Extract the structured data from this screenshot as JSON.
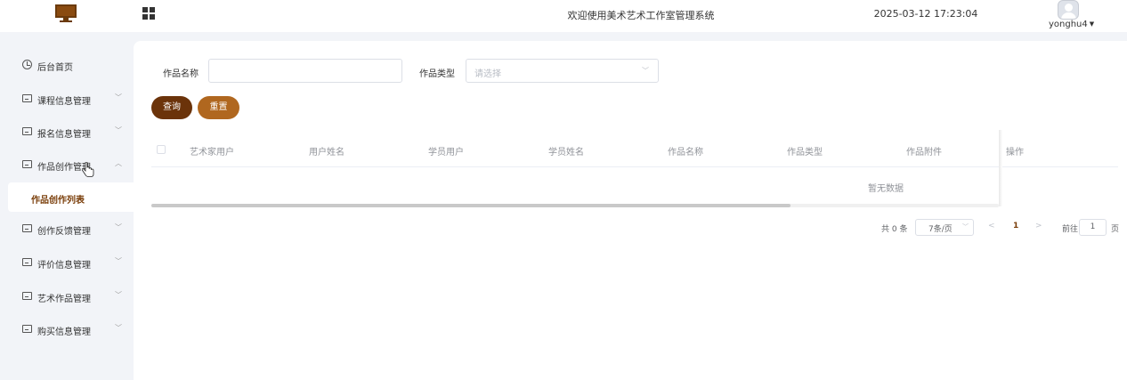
{
  "header": {
    "system_title": "欢迎使用美术艺术工作室管理系统",
    "datetime": "2025-03-12 17:23:04",
    "username": "yonghu4",
    "icons": [
      "monitor-logo-icon",
      "grid-menu-icon",
      "avatar-icon",
      "caret-down-icon"
    ]
  },
  "sidebar": {
    "items": [
      {
        "label": "后台首页",
        "icon": "clock-icon"
      },
      {
        "label": "课程信息管理",
        "icon": "panel-icon"
      },
      {
        "label": "报名信息管理",
        "icon": "panel-icon"
      },
      {
        "label": "作品创作管理",
        "icon": "panel-icon",
        "expanded": true
      },
      {
        "label": "创作反馈管理",
        "icon": "panel-icon"
      },
      {
        "label": "评价信息管理",
        "icon": "panel-icon"
      },
      {
        "label": "艺术作品管理",
        "icon": "panel-icon"
      },
      {
        "label": "购买信息管理",
        "icon": "panel-icon"
      }
    ],
    "active_submenu": "作品创作列表",
    "accent_color": "#7a3e0a"
  },
  "search": {
    "name_label": "作品名称",
    "name_value": "",
    "type_label": "作品类型",
    "type_placeholder": "请选择",
    "query_label": "查询",
    "reset_label": "重置",
    "query_color": "#6b330a",
    "reset_color": "#b0671f"
  },
  "table": {
    "columns": [
      "艺术家用户",
      "用户姓名",
      "学员用户",
      "学员姓名",
      "作品名称",
      "作品类型",
      "作品附件",
      "操作"
    ],
    "rows": [],
    "empty_text": "暂无数据"
  },
  "pagination": {
    "total_text": "共 0 条",
    "page_size": "7条/页",
    "current_page": "1",
    "goto_label": "前往",
    "goto_value": "1",
    "page_suffix": "页"
  }
}
